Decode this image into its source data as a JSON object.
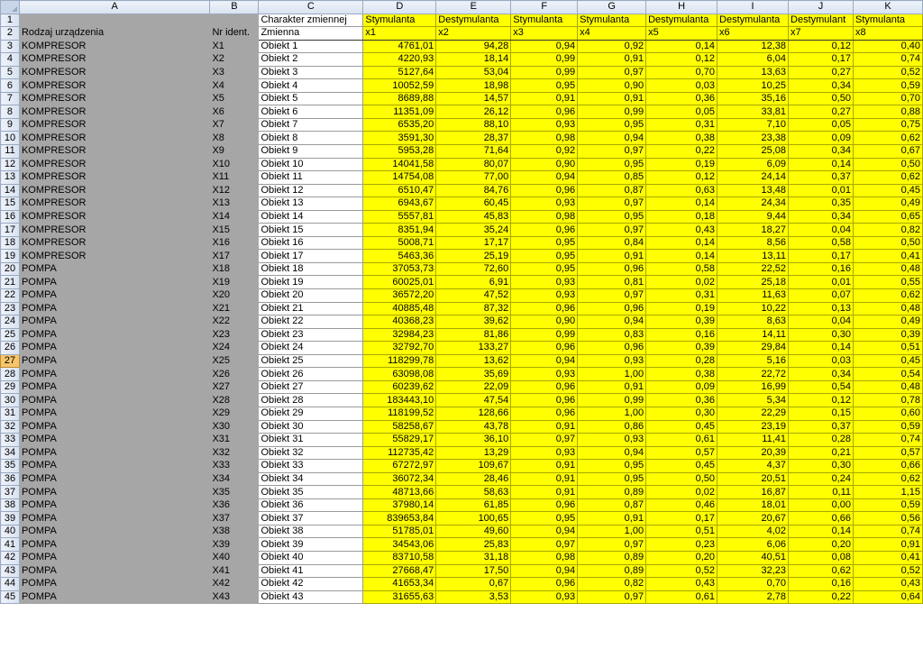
{
  "columns": [
    "A",
    "B",
    "C",
    "D",
    "E",
    "F",
    "G",
    "H",
    "I",
    "J",
    "K"
  ],
  "header_row_1": [
    "",
    "",
    "Charakter zmiennej",
    "Stymulanta",
    "Destymulanta",
    "Stymulanta",
    "Stymulanta",
    "Destymulanta",
    "Destymulanta",
    "Destymulant",
    "Stymulanta"
  ],
  "header_row_2": [
    "Rodzaj urządzenia",
    "Nr ident.",
    "Zmienna",
    "x1",
    "x2",
    "x3",
    "x4",
    "x5",
    "x6",
    "x7",
    "x8"
  ],
  "active_row": 27,
  "rows": [
    [
      "KOMPRESOR",
      "X1",
      "Obiekt 1",
      "4761,01",
      "94,28",
      "0,94",
      "0,92",
      "0,14",
      "12,38",
      "0,12",
      "0,40"
    ],
    [
      "KOMPRESOR",
      "X2",
      "Obiekt 2",
      "4220,93",
      "18,14",
      "0,99",
      "0,91",
      "0,12",
      "6,04",
      "0,17",
      "0,74"
    ],
    [
      "KOMPRESOR",
      "X3",
      "Obiekt 3",
      "5127,64",
      "53,04",
      "0,99",
      "0,97",
      "0,70",
      "13,63",
      "0,27",
      "0,52"
    ],
    [
      "KOMPRESOR",
      "X4",
      "Obiekt 4",
      "10052,59",
      "18,98",
      "0,95",
      "0,90",
      "0,03",
      "10,25",
      "0,34",
      "0,59"
    ],
    [
      "KOMPRESOR",
      "X5",
      "Obiekt 5",
      "8689,88",
      "14,57",
      "0,91",
      "0,91",
      "0,36",
      "35,16",
      "0,50",
      "0,70"
    ],
    [
      "KOMPRESOR",
      "X6",
      "Obiekt 6",
      "11351,09",
      "26,12",
      "0,96",
      "0,99",
      "0,05",
      "33,81",
      "0,27",
      "0,88"
    ],
    [
      "KOMPRESOR",
      "X7",
      "Obiekt 7",
      "6535,20",
      "88,10",
      "0,93",
      "0,95",
      "0,31",
      "7,10",
      "0,05",
      "0,75"
    ],
    [
      "KOMPRESOR",
      "X8",
      "Obiekt 8",
      "3591,30",
      "28,37",
      "0,98",
      "0,94",
      "0,38",
      "23,38",
      "0,09",
      "0,62"
    ],
    [
      "KOMPRESOR",
      "X9",
      "Obiekt 9",
      "5953,28",
      "71,64",
      "0,92",
      "0,97",
      "0,22",
      "25,08",
      "0,34",
      "0,67"
    ],
    [
      "KOMPRESOR",
      "X10",
      "Obiekt 10",
      "14041,58",
      "80,07",
      "0,90",
      "0,95",
      "0,19",
      "6,09",
      "0,14",
      "0,50"
    ],
    [
      "KOMPRESOR",
      "X11",
      "Obiekt 11",
      "14754,08",
      "77,00",
      "0,94",
      "0,85",
      "0,12",
      "24,14",
      "0,37",
      "0,62"
    ],
    [
      "KOMPRESOR",
      "X12",
      "Obiekt 12",
      "6510,47",
      "84,76",
      "0,96",
      "0,87",
      "0,63",
      "13,48",
      "0,01",
      "0,45"
    ],
    [
      "KOMPRESOR",
      "X13",
      "Obiekt 13",
      "6943,67",
      "60,45",
      "0,93",
      "0,97",
      "0,14",
      "24,34",
      "0,35",
      "0,49"
    ],
    [
      "KOMPRESOR",
      "X14",
      "Obiekt 14",
      "5557,81",
      "45,83",
      "0,98",
      "0,95",
      "0,18",
      "9,44",
      "0,34",
      "0,65"
    ],
    [
      "KOMPRESOR",
      "X15",
      "Obiekt 15",
      "8351,94",
      "35,24",
      "0,96",
      "0,97",
      "0,43",
      "18,27",
      "0,04",
      "0,82"
    ],
    [
      "KOMPRESOR",
      "X16",
      "Obiekt 16",
      "5008,71",
      "17,17",
      "0,95",
      "0,84",
      "0,14",
      "8,56",
      "0,58",
      "0,50"
    ],
    [
      "KOMPRESOR",
      "X17",
      "Obiekt 17",
      "5463,36",
      "25,19",
      "0,95",
      "0,91",
      "0,14",
      "13,11",
      "0,17",
      "0,41"
    ],
    [
      "POMPA",
      "X18",
      "Obiekt 18",
      "37053,73",
      "72,60",
      "0,95",
      "0,96",
      "0,58",
      "22,52",
      "0,16",
      "0,48"
    ],
    [
      "POMPA",
      "X19",
      "Obiekt 19",
      "60025,01",
      "6,91",
      "0,93",
      "0,81",
      "0,02",
      "25,18",
      "0,01",
      "0,55"
    ],
    [
      "POMPA",
      "X20",
      "Obiekt 20",
      "36572,20",
      "47,52",
      "0,93",
      "0,97",
      "0,31",
      "11,63",
      "0,07",
      "0,62"
    ],
    [
      "POMPA",
      "X21",
      "Obiekt 21",
      "40885,48",
      "87,32",
      "0,96",
      "0,96",
      "0,19",
      "10,22",
      "0,13",
      "0,48"
    ],
    [
      "POMPA",
      "X22",
      "Obiekt 22",
      "40368,23",
      "39,62",
      "0,90",
      "0,94",
      "0,39",
      "8,63",
      "0,04",
      "0,49"
    ],
    [
      "POMPA",
      "X23",
      "Obiekt 23",
      "32984,23",
      "81,86",
      "0,99",
      "0,83",
      "0,16",
      "14,11",
      "0,30",
      "0,39"
    ],
    [
      "POMPA",
      "X24",
      "Obiekt 24",
      "32792,70",
      "133,27",
      "0,96",
      "0,96",
      "0,39",
      "29,84",
      "0,14",
      "0,51"
    ],
    [
      "POMPA",
      "X25",
      "Obiekt 25",
      "118299,78",
      "13,62",
      "0,94",
      "0,93",
      "0,28",
      "5,16",
      "0,03",
      "0,45"
    ],
    [
      "POMPA",
      "X26",
      "Obiekt 26",
      "63098,08",
      "35,69",
      "0,93",
      "1,00",
      "0,38",
      "22,72",
      "0,34",
      "0,54"
    ],
    [
      "POMPA",
      "X27",
      "Obiekt 27",
      "60239,62",
      "22,09",
      "0,96",
      "0,91",
      "0,09",
      "16,99",
      "0,54",
      "0,48"
    ],
    [
      "POMPA",
      "X28",
      "Obiekt 28",
      "183443,10",
      "47,54",
      "0,96",
      "0,99",
      "0,36",
      "5,34",
      "0,12",
      "0,78"
    ],
    [
      "POMPA",
      "X29",
      "Obiekt 29",
      "118199,52",
      "128,66",
      "0,96",
      "1,00",
      "0,30",
      "22,29",
      "0,15",
      "0,60"
    ],
    [
      "POMPA",
      "X30",
      "Obiekt 30",
      "58258,67",
      "43,78",
      "0,91",
      "0,86",
      "0,45",
      "23,19",
      "0,37",
      "0,59"
    ],
    [
      "POMPA",
      "X31",
      "Obiekt 31",
      "55829,17",
      "36,10",
      "0,97",
      "0,93",
      "0,61",
      "11,41",
      "0,28",
      "0,74"
    ],
    [
      "POMPA",
      "X32",
      "Obiekt 32",
      "112735,42",
      "13,29",
      "0,93",
      "0,94",
      "0,57",
      "20,39",
      "0,21",
      "0,57"
    ],
    [
      "POMPA",
      "X33",
      "Obiekt 33",
      "67272,97",
      "109,67",
      "0,91",
      "0,95",
      "0,45",
      "4,37",
      "0,30",
      "0,66"
    ],
    [
      "POMPA",
      "X34",
      "Obiekt 34",
      "36072,34",
      "28,46",
      "0,91",
      "0,95",
      "0,50",
      "20,51",
      "0,24",
      "0,62"
    ],
    [
      "POMPA",
      "X35",
      "Obiekt 35",
      "48713,66",
      "58,63",
      "0,91",
      "0,89",
      "0,02",
      "16,87",
      "0,11",
      "1,15"
    ],
    [
      "POMPA",
      "X36",
      "Obiekt 36",
      "37980,14",
      "61,85",
      "0,96",
      "0,87",
      "0,46",
      "18,01",
      "0,00",
      "0,59"
    ],
    [
      "POMPA",
      "X37",
      "Obiekt 37",
      "839653,84",
      "100,65",
      "0,95",
      "0,91",
      "0,17",
      "20,67",
      "0,66",
      "0,56"
    ],
    [
      "POMPA",
      "X38",
      "Obiekt 38",
      "51785,01",
      "49,60",
      "0,94",
      "1,00",
      "0,51",
      "4,02",
      "0,14",
      "0,74"
    ],
    [
      "POMPA",
      "X39",
      "Obiekt 39",
      "34543,06",
      "25,83",
      "0,97",
      "0,97",
      "0,23",
      "6,06",
      "0,20",
      "0,91"
    ],
    [
      "POMPA",
      "X40",
      "Obiekt 40",
      "83710,58",
      "31,18",
      "0,98",
      "0,89",
      "0,20",
      "40,51",
      "0,08",
      "0,41"
    ],
    [
      "POMPA",
      "X41",
      "Obiekt 41",
      "27668,47",
      "17,50",
      "0,94",
      "0,89",
      "0,52",
      "32,23",
      "0,62",
      "0,52"
    ],
    [
      "POMPA",
      "X42",
      "Obiekt 42",
      "41653,34",
      "0,67",
      "0,96",
      "0,82",
      "0,43",
      "0,70",
      "0,16",
      "0,43"
    ],
    [
      "POMPA",
      "X43",
      "Obiekt 43",
      "31655,63",
      "3,53",
      "0,93",
      "0,97",
      "0,61",
      "2,78",
      "0,22",
      "0,64"
    ]
  ]
}
